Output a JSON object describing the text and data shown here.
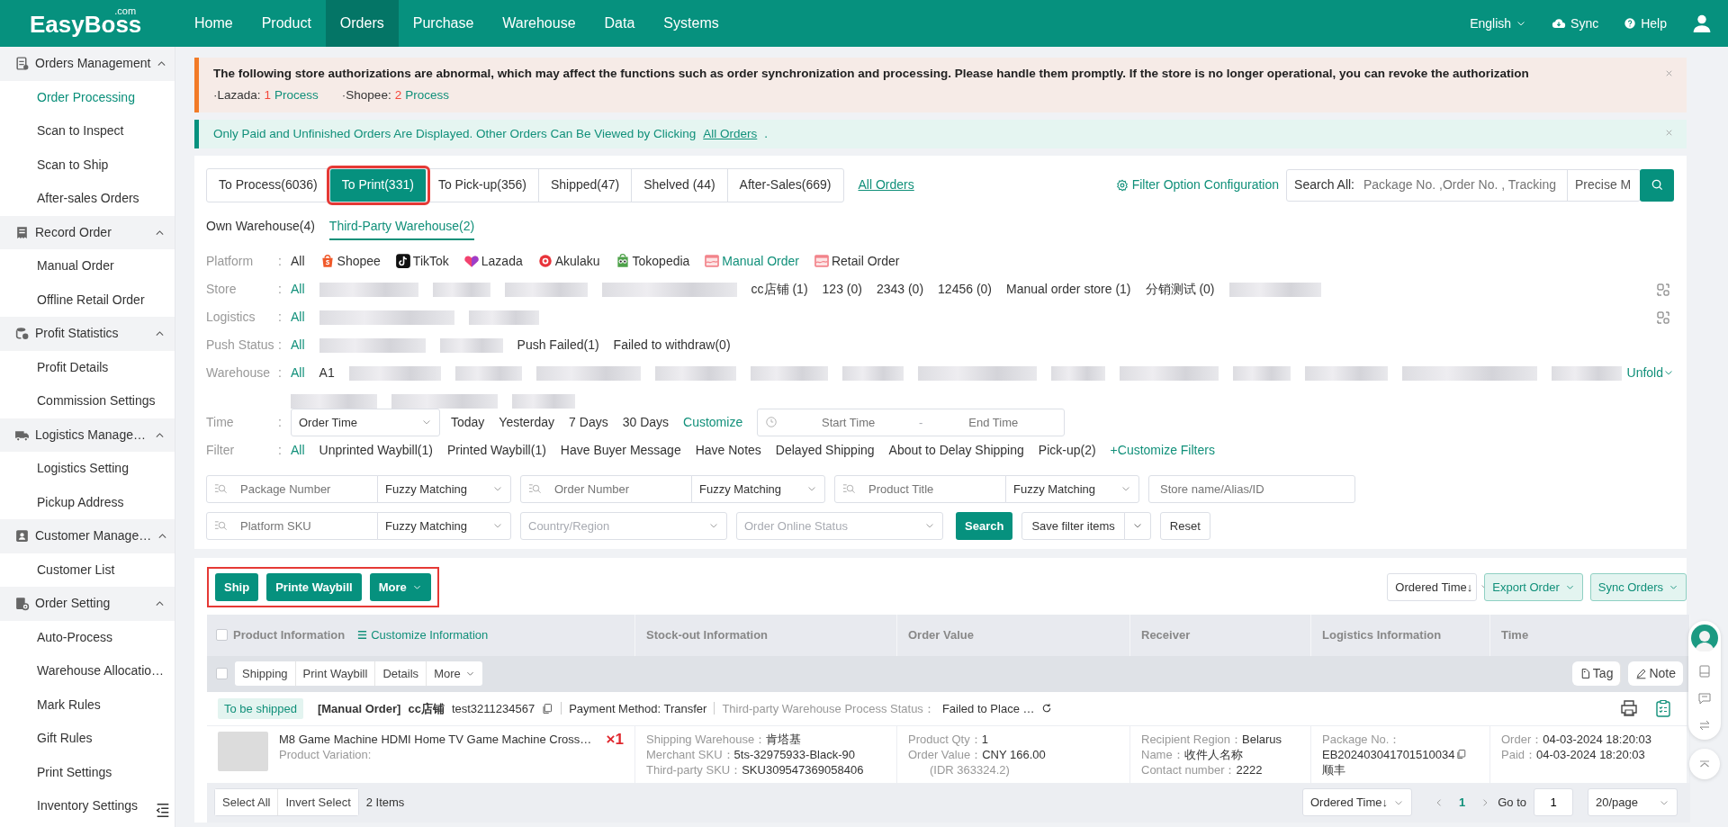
{
  "logo": {
    "name": "EasyBoss",
    "suffix": ".com"
  },
  "nav": [
    {
      "label": "Home",
      "selected": false
    },
    {
      "label": "Product",
      "selected": false
    },
    {
      "label": "Orders",
      "selected": true
    },
    {
      "label": "Purchase",
      "selected": false
    },
    {
      "label": "Warehouse",
      "selected": false
    },
    {
      "label": "Data",
      "selected": false
    },
    {
      "label": "Systems",
      "selected": false
    }
  ],
  "header_tools": {
    "language": "English",
    "sync": "Sync",
    "help": "Help"
  },
  "sidebar": [
    {
      "label": "Orders Management",
      "expanded": true,
      "children": [
        {
          "label": "Order Processing",
          "selected": true
        },
        {
          "label": "Scan to Inspect",
          "selected": false
        },
        {
          "label": "Scan to Ship",
          "selected": false
        },
        {
          "label": "After-sales Orders",
          "selected": false
        }
      ]
    },
    {
      "label": "Record Order",
      "expanded": true,
      "children": [
        {
          "label": "Manual Order",
          "selected": false
        },
        {
          "label": "Offline Retail Order",
          "selected": false
        }
      ]
    },
    {
      "label": "Profit Statistics",
      "expanded": true,
      "children": [
        {
          "label": "Profit Details",
          "selected": false
        },
        {
          "label": "Commission Settings",
          "selected": false
        }
      ]
    },
    {
      "label": "Logistics Manage…",
      "expanded": true,
      "children": [
        {
          "label": "Logistics Setting",
          "selected": false
        },
        {
          "label": "Pickup Address",
          "selected": false
        }
      ]
    },
    {
      "label": "Customer Manage…",
      "expanded": true,
      "children": [
        {
          "label": "Customer List",
          "selected": false
        }
      ]
    },
    {
      "label": "Order Setting",
      "expanded": true,
      "children": [
        {
          "label": "Auto-Process",
          "selected": false
        },
        {
          "label": "Warehouse Allocatio…",
          "selected": false
        },
        {
          "label": "Mark Rules",
          "selected": false
        },
        {
          "label": "Gift Rules",
          "selected": false
        },
        {
          "label": "Print Settings",
          "selected": false
        },
        {
          "label": "Inventory Settings",
          "selected": false
        }
      ]
    }
  ],
  "alerts": [
    {
      "kind": "warning",
      "text": "The following store authorizations are abnormal, which may affect the functions such as order synchronization and processing. Please handle them promptly. If the store is no longer operational, you can revoke the authorization",
      "items": [
        {
          "label": "·Lazada:",
          "count": "1",
          "action": "Process"
        },
        {
          "label": "·Shopee:",
          "count": "2",
          "action": "Process"
        }
      ]
    },
    {
      "kind": "info",
      "text": "Only Paid and Unfinished Orders Are Displayed. Other Orders Can Be Viewed by Clicking",
      "link": "All Orders",
      "tail": "."
    }
  ],
  "status_tabs": [
    {
      "label": "To Process(6036)",
      "selected": false,
      "highlighted": false
    },
    {
      "label": "To Print(331)",
      "selected": true,
      "highlighted": true
    },
    {
      "label": "To Pick-up(356)",
      "selected": false,
      "highlighted": false
    },
    {
      "label": "Shipped(47)",
      "selected": false,
      "highlighted": false
    },
    {
      "label": "Shelved (44)",
      "selected": false,
      "highlighted": false
    },
    {
      "label": "After-Sales(669)",
      "selected": false,
      "highlighted": false
    }
  ],
  "all_orders_link": "All Orders",
  "filter_config": "Filter Option Configuration",
  "global_search": {
    "label": "Search All:",
    "placeholder": "Package No. ,Order No. , Tracking",
    "mode": "Precise M"
  },
  "warehouse_tabs": [
    {
      "label": "Own Warehouse(4)",
      "selected": false
    },
    {
      "label": "Third-Party Warehouse(2)",
      "selected": true
    }
  ],
  "filters": [
    {
      "kind": "options",
      "label": "Platform",
      "sep": ":",
      "options": [
        {
          "kind": "option",
          "text": "All",
          "selected": false
        },
        {
          "kind": "bag",
          "text": "Shopee",
          "selected": false
        },
        {
          "kind": "note",
          "text": "TikTok",
          "selected": false
        },
        {
          "kind": "heart",
          "text": "Lazada",
          "selected": false
        },
        {
          "kind": "ring",
          "text": "Akulaku",
          "selected": false
        },
        {
          "kind": "owl",
          "text": "Tokopedia",
          "selected": false
        },
        {
          "kind": "sheet",
          "text": "Manual Order",
          "selected": true
        },
        {
          "kind": "sheet",
          "text": "Retail Order",
          "selected": false
        }
      ]
    },
    {
      "kind": "options",
      "label": "Store",
      "sep": ":",
      "copyable": true,
      "options": [
        {
          "kind": "option",
          "text": "All",
          "selected": true
        },
        {
          "kind": "blurred"
        },
        {
          "kind": "blurred"
        },
        {
          "kind": "blurred"
        },
        {
          "kind": "blurred"
        },
        {
          "kind": "option",
          "text": "cc店铺 (1)",
          "selected": false
        },
        {
          "kind": "option",
          "text": "123 (0)",
          "selected": false
        },
        {
          "kind": "option",
          "text": "2343 (0)",
          "selected": false
        },
        {
          "kind": "option",
          "text": "12456 (0)",
          "selected": false
        },
        {
          "kind": "option",
          "text": "Manual order store (1)",
          "selected": false
        },
        {
          "kind": "option",
          "text": "分销测试 (0)",
          "selected": false
        },
        {
          "kind": "blurred"
        }
      ]
    },
    {
      "kind": "options",
      "label": "Logistics",
      "sep": ":",
      "copyable": true,
      "options": [
        {
          "kind": "option",
          "text": "All",
          "selected": true
        },
        {
          "kind": "blurred"
        },
        {
          "kind": "blurred"
        }
      ]
    },
    {
      "kind": "options",
      "label": "Push Status",
      "sep": ":",
      "options": [
        {
          "kind": "option",
          "text": "All",
          "selected": true
        },
        {
          "kind": "blurred"
        },
        {
          "kind": "blurred"
        },
        {
          "kind": "option",
          "text": "Push Failed(1)",
          "selected": false
        },
        {
          "kind": "option",
          "text": "Failed to withdraw(0)",
          "selected": false
        }
      ]
    },
    {
      "kind": "options",
      "label": "Warehouse",
      "sep": ":",
      "unfold": "Unfold",
      "options": [
        {
          "kind": "option",
          "text": "All",
          "selected": true
        },
        {
          "kind": "option",
          "text": "A1",
          "selected": false
        },
        {
          "kind": "blurred"
        },
        {
          "kind": "blurred"
        },
        {
          "kind": "blurred"
        },
        {
          "kind": "blurred"
        },
        {
          "kind": "blurred"
        },
        {
          "kind": "blurred"
        },
        {
          "kind": "blurred"
        },
        {
          "kind": "blurred"
        },
        {
          "kind": "blurred"
        },
        {
          "kind": "blurred"
        },
        {
          "kind": "blurred"
        },
        {
          "kind": "blurred"
        },
        {
          "kind": "blurred"
        },
        {
          "kind": "blurred"
        },
        {
          "kind": "blurred"
        },
        {
          "kind": "blurred"
        }
      ]
    },
    {
      "kind": "time",
      "label": "Time",
      "sep": ":",
      "field": "Order Time",
      "presets": [
        {
          "text": "Today",
          "selected": false
        },
        {
          "text": "Yesterday",
          "selected": false
        },
        {
          "text": "7 Days",
          "selected": false
        },
        {
          "text": "30 Days",
          "selected": false
        },
        {
          "text": "Customize",
          "selected": true
        }
      ],
      "start_placeholder": "Start Time",
      "range_sep": "-",
      "end_placeholder": "End Time"
    },
    {
      "kind": "options",
      "label": "Filter",
      "sep": ":",
      "options": [
        {
          "kind": "option",
          "text": "All",
          "selected": true
        },
        {
          "kind": "option",
          "text": "Unprinted Waybill(1)",
          "selected": false
        },
        {
          "kind": "option",
          "text": "Printed Waybill(1)",
          "selected": false
        },
        {
          "kind": "option",
          "text": "Have Buyer Message",
          "selected": false
        },
        {
          "kind": "option",
          "text": "Have Notes",
          "selected": false
        },
        {
          "kind": "option",
          "text": "Delayed Shipping",
          "selected": false
        },
        {
          "kind": "option",
          "text": "About to Delay Shipping",
          "selected": false
        },
        {
          "kind": "option",
          "text": "Pick-up(2)",
          "selected": false
        },
        {
          "kind": "link",
          "text": "+Customize Filters"
        }
      ]
    }
  ],
  "search_fields": [
    [
      {
        "kind": "match",
        "placeholder": "Package Number",
        "mode": "Fuzzy Matching"
      },
      {
        "kind": "match",
        "placeholder": "Order Number",
        "mode": "Fuzzy Matching"
      },
      {
        "kind": "match",
        "placeholder": "Product Title",
        "mode": "Fuzzy Matching"
      },
      {
        "kind": "text",
        "placeholder": "Store name/Alias/ID"
      }
    ],
    [
      {
        "kind": "match",
        "placeholder": "Platform SKU",
        "mode": "Fuzzy Matching"
      },
      {
        "kind": "select",
        "placeholder": "Country/Region"
      },
      {
        "kind": "select",
        "placeholder": "Order Online Status"
      }
    ]
  ],
  "search_buttons": {
    "search": "Search",
    "save": "Save filter items",
    "reset": "Reset"
  },
  "actions": {
    "highlighted": true,
    "buttons": [
      {
        "label": "Ship",
        "dropdown": false
      },
      {
        "label": "Printe Waybill",
        "dropdown": false
      },
      {
        "label": "More",
        "dropdown": true
      }
    ]
  },
  "sort_select": "Ordered Time↓",
  "export_buttons": [
    "Export Order",
    "Sync Orders"
  ],
  "table": {
    "select_all_checked": false,
    "group_checked": false,
    "columns": [
      "Product Information",
      "Stock-out Information",
      "Order Value",
      "Receiver",
      "Logistics Information",
      "Time"
    ],
    "customize": "Customize Information",
    "row_actions": [
      {
        "label": "Shipping",
        "dropdown": false
      },
      {
        "label": "Print Waybill",
        "dropdown": false
      },
      {
        "label": "Details",
        "dropdown": false
      },
      {
        "label": "More",
        "dropdown": true
      }
    ],
    "tag": "Tag",
    "note": "Note",
    "orders": [
      {
        "status": "To be shipped",
        "type": "[Manual Order]",
        "store": "cc店铺",
        "order_no": "test3211234567",
        "payment": "Payment Method: Transfer",
        "process_label": "Third-party Warehouse Process Status：",
        "process_status": "Failed to Place …",
        "product": {
          "title": "M8 Game Machine HDMI Home TV Game Machine Cross…",
          "variation": "Product Variation:",
          "qty": "×1"
        },
        "stock": [
          {
            "label": "Shipping Warehouse：",
            "value": "肯塔基"
          },
          {
            "label": "Merchant SKU：",
            "value": "5ts-32975933-Black-90"
          },
          {
            "label": "Third-party SKU：",
            "value": "SKU309547369058406"
          }
        ],
        "value": [
          {
            "label": "Product Qty：",
            "value": "1"
          },
          {
            "label": "Order Value：",
            "value": "CNY 166.00"
          },
          {
            "note": "(IDR 363324.2)"
          }
        ],
        "receiver": [
          {
            "label": "Recipient Region：",
            "value": "Belarus"
          },
          {
            "label": "Name：",
            "value": "收件人名称"
          },
          {
            "label": "Contact number：",
            "value": "2222"
          }
        ],
        "logistics": [
          {
            "label": "Package No.："
          },
          {
            "value": "EB202403041701510034",
            "copyable": true
          },
          {
            "value": "顺丰"
          }
        ],
        "time": [
          {
            "label": "Order：",
            "value": "04-03-2024 18:20:03"
          },
          {
            "label": "Paid：",
            "value": "04-03-2024 18:20:03"
          }
        ]
      }
    ]
  },
  "footer": {
    "select_all": "Select All",
    "invert": "Invert Select",
    "count": "2 Items",
    "sort": "Ordered Time↓",
    "page": "1",
    "goto_label": "Go to",
    "goto_value": "1",
    "page_size": "20/page"
  }
}
